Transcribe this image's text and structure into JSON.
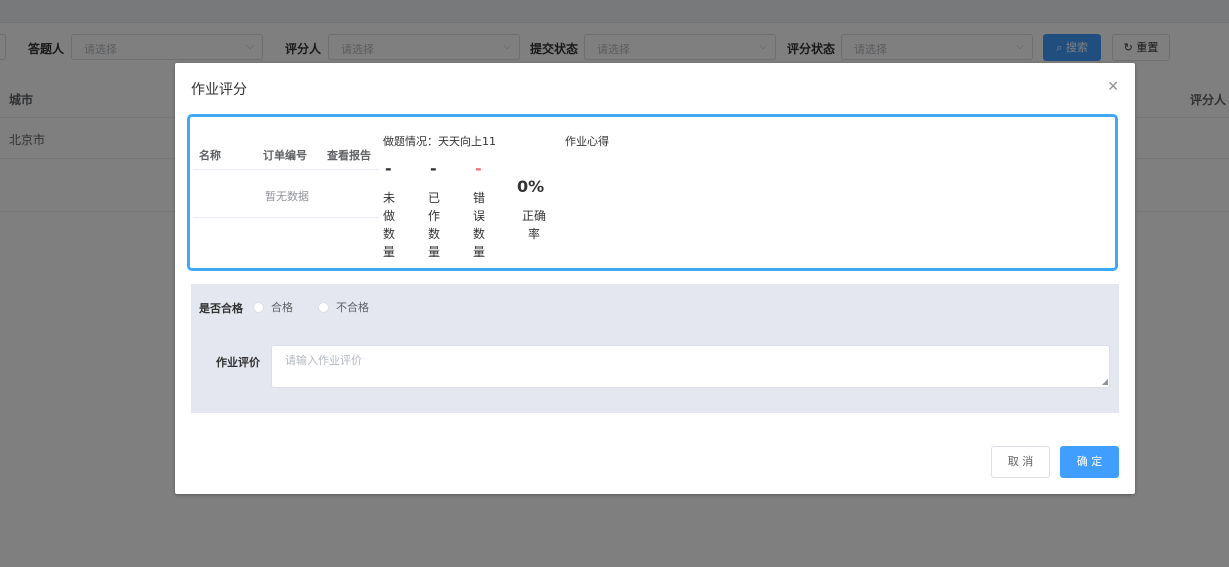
{
  "filters": {
    "answerer_label": "答题人",
    "grader_label": "评分人",
    "submit_status_label": "提交状态",
    "grade_status_label": "评分状态",
    "select_placeholder": "请选择",
    "search_button": "搜索",
    "reset_button": "重置"
  },
  "background_table": {
    "col_city": "城市",
    "col_grader": "评分人",
    "row_city": "北京市"
  },
  "dialog": {
    "title": "作业评分",
    "report_table": {
      "headers": [
        "名称",
        "订单编号",
        "查看报告"
      ],
      "empty_text": "暂无数据"
    },
    "stats": {
      "title_prefix": "做题情况：",
      "title_name": "天天向上11",
      "items": [
        {
          "value": "-",
          "label": "未做数量"
        },
        {
          "value": "-",
          "label": "已作数量"
        },
        {
          "value": "-",
          "label": "错误数量"
        }
      ],
      "rate_value": "0%",
      "rate_label": "正确率"
    },
    "experience_title": "作业心得",
    "form": {
      "qualified_label": "是否合格",
      "option_pass": "合格",
      "option_fail": "不合格",
      "eval_label": "作业评价",
      "eval_placeholder": "请输入作业评价"
    },
    "cancel_button": "取 消",
    "confirm_button": "确 定"
  },
  "colors": {
    "primary": "#409eff",
    "highlight_border": "#3fa9f5",
    "error": "#f56c6c",
    "form_bg": "#e4e7f0"
  }
}
